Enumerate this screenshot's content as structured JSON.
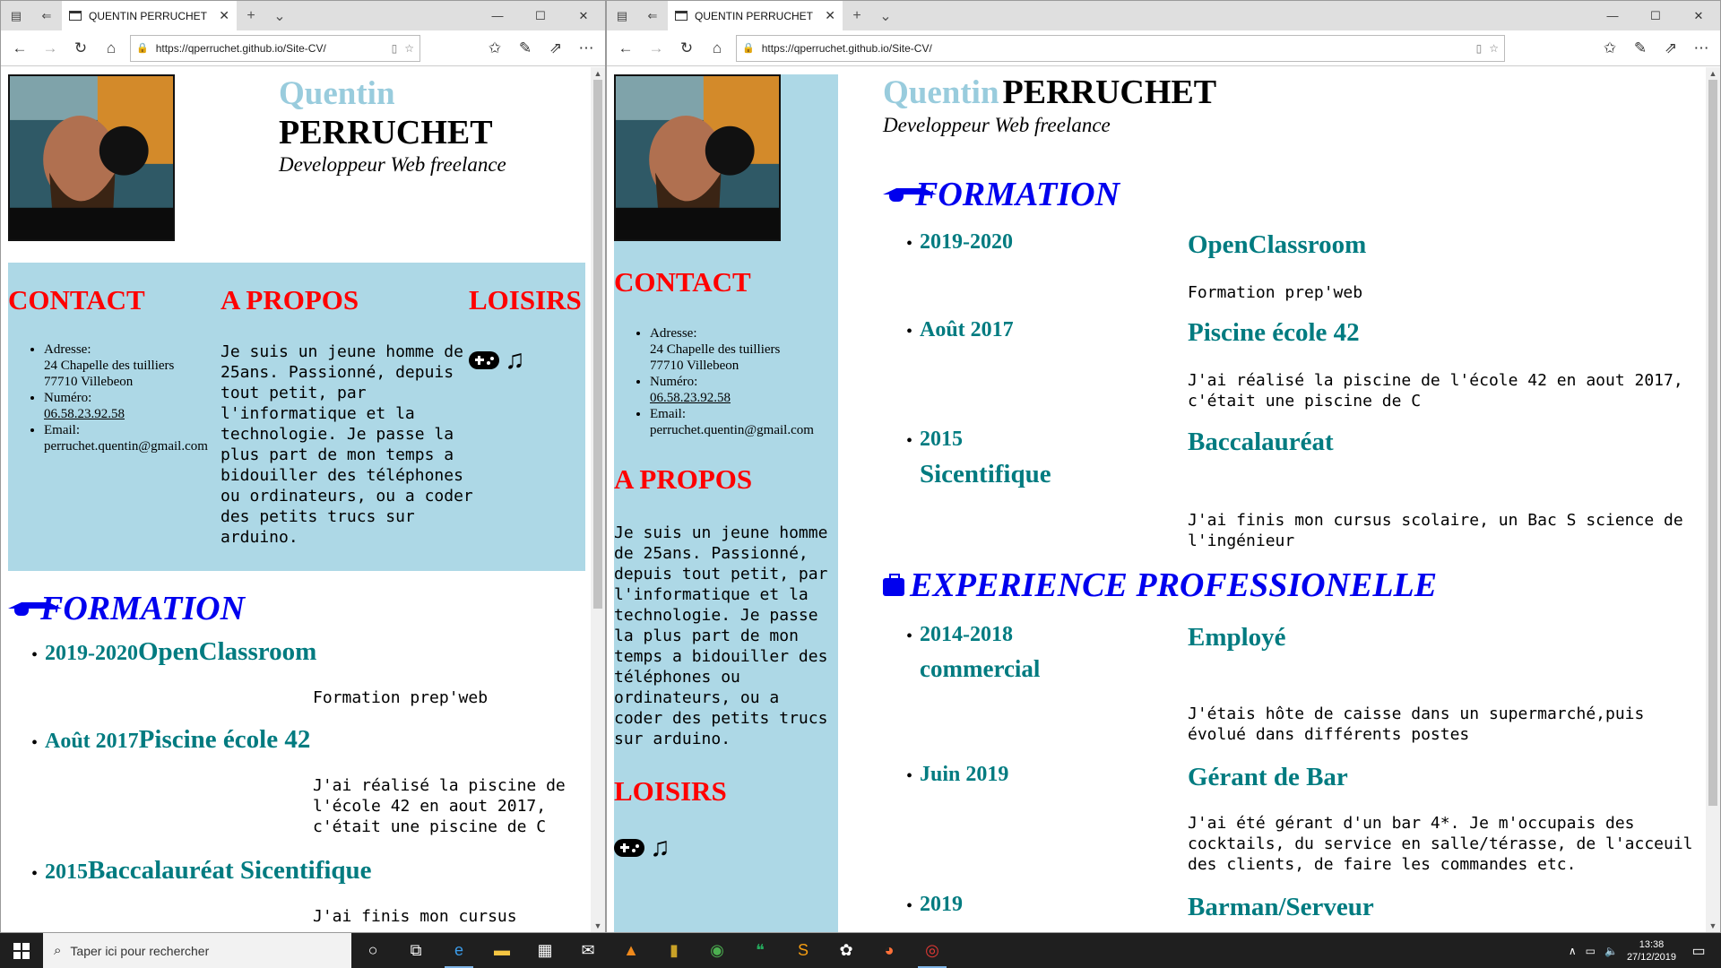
{
  "browser": {
    "tab_title": "QUENTIN PERRUCHET",
    "url": "https://qperruchet.github.io/Site-CV/"
  },
  "cv": {
    "first_name": "Quentin",
    "last_name": "PERRUCHET",
    "role": "Developpeur Web freelance",
    "contact_title": "CONTACT",
    "about_title": "A PROPOS",
    "hobbies_title": "LOISIRS",
    "address_label": "Adresse:",
    "address_line1": "24 Chapelle des tuilliers",
    "address_line2": "77710 Villebeon",
    "phone_label": "Numéro:",
    "phone": "06.58.23.92.58",
    "email_label": "Email:",
    "email": "perruchet.quentin@gmail.com",
    "about_text": "Je suis un jeune homme de 25ans. Passionné, depuis tout petit, par l'informatique et la technologie. Je passe la plus part de mon temps a bidouiller des téléphones ou ordinateurs, ou a coder des petits trucs sur arduino.",
    "formation_title": "FORMATION",
    "experience_title": "EXPERIENCE PROFESSIONELLE",
    "formation": [
      {
        "date": "2019-2020",
        "title": "OpenClassroom",
        "desc": "Formation prep'web"
      },
      {
        "date": "Août 2017",
        "title": "Piscine école 42",
        "desc": "J'ai réalisé la piscine de l'école 42 en aout 2017, c'était une piscine de C"
      },
      {
        "date": "2015",
        "title": "Baccalauréat Sicentifique",
        "title_a": "Baccalauréat",
        "title_b": "Sicentifique",
        "desc": "J'ai finis mon cursus scolaire, un Bac S science de l'ingénieur",
        "desc_left_partial": "J'ai finis mon cursus"
      }
    ],
    "experience": [
      {
        "date": "2014-2018",
        "title_a": "Employé",
        "title_b": "commercial",
        "desc": "J'étais hôte de caisse dans un supermarché,puis évolué dans différents postes"
      },
      {
        "date": "Juin 2019",
        "title": "Gérant de Bar",
        "desc": "J'ai été gérant d'un bar 4*. Je m'occupais des cocktails, du service en salle/térasse, de l'acceuil des clients, de faire les commandes etc."
      },
      {
        "date": "2019",
        "title": "Barman/Serveur"
      }
    ]
  },
  "taskbar": {
    "search_placeholder": "Taper ici pour rechercher",
    "time": "13:38",
    "date": "27/12/2019"
  }
}
